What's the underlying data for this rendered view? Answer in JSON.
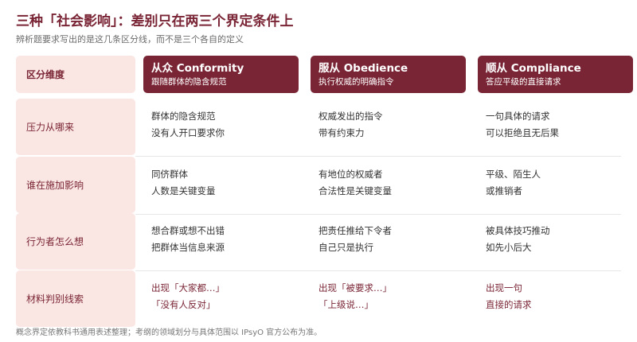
{
  "title": "三种「社会影响」：差别只在两三个界定条件上",
  "subtitle": "辨析题要求写出的是这几条区分线，而不是三个各自的定义",
  "header": {
    "dimension_label": "区分维度",
    "columns": [
      {
        "name": "从众 Conformity",
        "desc": "跟随群体的隐含规范"
      },
      {
        "name": "服从 Obedience",
        "desc": "执行权威的明确指令"
      },
      {
        "name": "顺从 Compliance",
        "desc": "答应平级的直接请求"
      }
    ]
  },
  "rows": [
    {
      "label": "压力从哪来",
      "cells": [
        {
          "lines": [
            "群体的隐含规范",
            "没有人开口要求你"
          ]
        },
        {
          "lines": [
            "权威发出的指令",
            "带有约束力"
          ]
        },
        {
          "lines": [
            "一句具体的请求",
            "可以拒绝且无后果"
          ]
        }
      ]
    },
    {
      "label": "谁在施加影响",
      "cells": [
        {
          "lines": [
            "同侪群体",
            "人数是关键变量"
          ]
        },
        {
          "lines": [
            "有地位的权威者",
            "合法性是关键变量"
          ]
        },
        {
          "lines": [
            "平级、陌生人",
            "或推销者"
          ]
        }
      ]
    },
    {
      "label": "行为者怎么想",
      "cells": [
        {
          "lines": [
            "想合群或想不出错",
            "把群体当信息来源"
          ]
        },
        {
          "lines": [
            "把责任推给下令者",
            "自己只是执行"
          ]
        },
        {
          "lines": [
            "被具体技巧推动",
            "如先小后大"
          ]
        }
      ]
    },
    {
      "label": "材料判别线索",
      "cells": [
        {
          "lines": [
            "出现「大家都…」",
            "「没有人反对」"
          ]
        },
        {
          "lines": [
            "出现「被要求…」",
            "「上级说…」"
          ]
        },
        {
          "lines": [
            "出现一句",
            "直接的请求"
          ]
        }
      ]
    }
  ],
  "footnote": "概念界定依教科书通用表述整理；考纲的领域划分与具体范围以 IPsyO 官方公布为准。",
  "colors": {
    "accent": "#7a2535",
    "label_bg": "#fae6e3"
  }
}
